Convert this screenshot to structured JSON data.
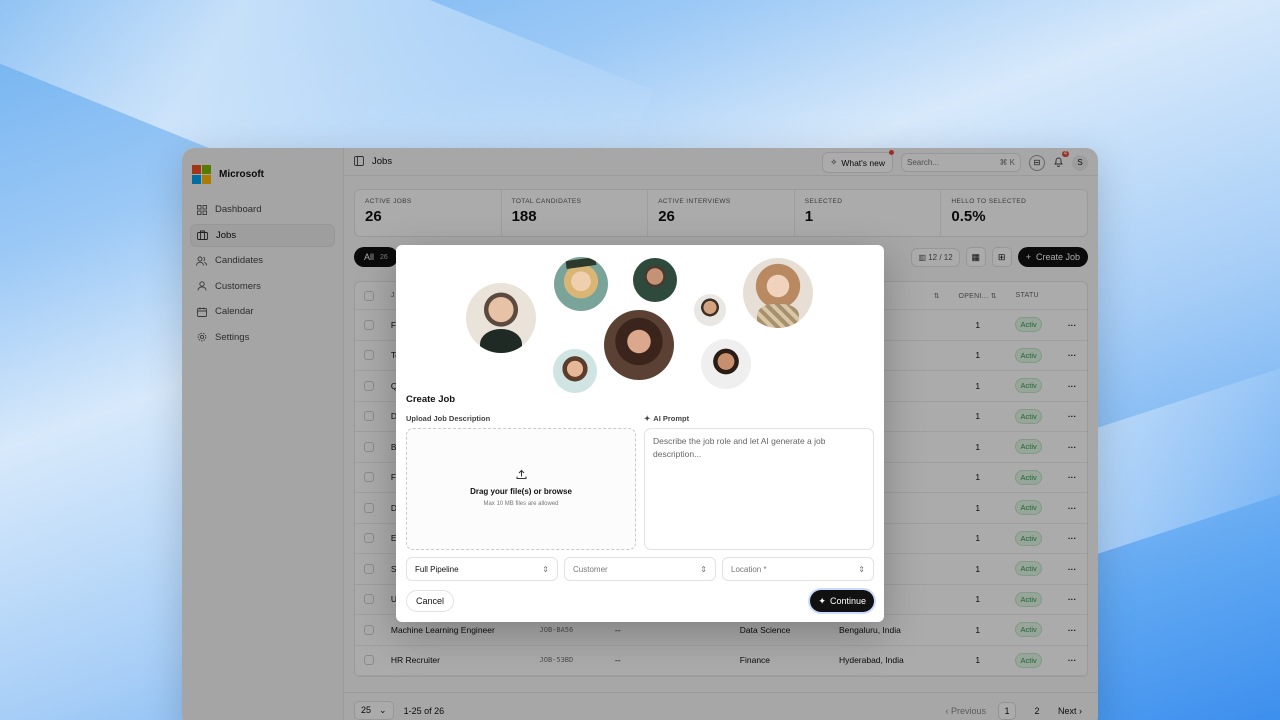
{
  "app": {
    "brand": "Microsoft",
    "brand_colors": [
      "#f25022",
      "#7fba00",
      "#00a4ef",
      "#ffb900"
    ]
  },
  "sidebar": {
    "items": [
      {
        "label": "Dashboard",
        "icon": "grid-icon"
      },
      {
        "label": "Jobs",
        "icon": "briefcase-icon",
        "active": true
      },
      {
        "label": "Candidates",
        "icon": "users-icon"
      },
      {
        "label": "Customers",
        "icon": "user-icon"
      },
      {
        "label": "Calendar",
        "icon": "calendar-icon"
      },
      {
        "label": "Settings",
        "icon": "gear-icon"
      }
    ]
  },
  "topbar": {
    "breadcrumb": "Jobs",
    "whats_new": "What's new",
    "search_placeholder": "Search...",
    "search_shortcut": "⌘ K",
    "notification_count": "4",
    "user_initial": "S"
  },
  "stats": [
    {
      "label": "ACTIVE JOBS",
      "value": "26"
    },
    {
      "label": "TOTAL CANDIDATES",
      "value": "188"
    },
    {
      "label": "ACTIVE INTERVIEWS",
      "value": "26"
    },
    {
      "label": "SELECTED",
      "value": "1"
    },
    {
      "label": "HELLO TO SELECTED",
      "value": "0.5%"
    }
  ],
  "toolbar": {
    "filter_all": "All",
    "filter_count": "26",
    "column_count": "12 / 12",
    "create_job": "Create Job"
  },
  "table": {
    "headers": {
      "title": "J",
      "openings": "OPENI...",
      "status": "STATU"
    },
    "rows": [
      {
        "title": "Fu",
        "code": "",
        "customer": "",
        "dept": "",
        "location": "u, India",
        "openings": "1",
        "status": "Activ"
      },
      {
        "title": "Te",
        "code": "",
        "customer": "",
        "dept": "",
        "location": "u, India",
        "openings": "1",
        "status": "Activ"
      },
      {
        "title": "Qu",
        "code": "",
        "customer": "",
        "dept": "",
        "location": "u, India",
        "openings": "1",
        "status": "Activ"
      },
      {
        "title": "Da",
        "code": "",
        "customer": "",
        "dept": "",
        "location": "u, India",
        "openings": "1",
        "status": "Activ"
      },
      {
        "title": "Ba",
        "code": "",
        "customer": "",
        "dept": "",
        "location": "u, India",
        "openings": "1",
        "status": "Activ"
      },
      {
        "title": "Fr",
        "code": "",
        "customer": "",
        "dept": "",
        "location": "u, India",
        "openings": "1",
        "status": "Activ"
      },
      {
        "title": "De",
        "code": "",
        "customer": "",
        "dept": "",
        "location": "u, India",
        "openings": "1",
        "status": "Activ"
      },
      {
        "title": "En",
        "code": "",
        "customer": "",
        "dept": "",
        "location": "u, India",
        "openings": "1",
        "status": "Activ"
      },
      {
        "title": "Sr",
        "code": "",
        "customer": "",
        "dept": "",
        "location": "u, India",
        "openings": "1",
        "status": "Activ"
      },
      {
        "title": "UX",
        "code": "",
        "customer": "",
        "dept": "",
        "location": "u, India",
        "openings": "1",
        "status": "Activ"
      },
      {
        "title": "Machine Learning Engineer",
        "code": "JOB-BA56",
        "customer": "--",
        "dept": "Data Science",
        "location": "Bengaluru, India",
        "openings": "1",
        "status": "Activ"
      },
      {
        "title": "HR Recruiter",
        "code": "JOB-53BD",
        "customer": "--",
        "dept": "Finance",
        "location": "Hyderabad, India",
        "openings": "1",
        "status": "Activ"
      }
    ]
  },
  "footer": {
    "per_page": "25",
    "range": "1-25 of 26",
    "previous": "Previous",
    "pages": [
      "1",
      "2"
    ],
    "next": "Next"
  },
  "modal": {
    "title": "Create Job",
    "upload_label": "Upload Job Description",
    "dropzone_title": "Drag your file(s) or browse",
    "dropzone_sub": "Max 10 MB files are allowed",
    "ai_label": "AI Prompt",
    "ai_placeholder": "Describe the job role and let AI generate a job description...",
    "pipeline_select": "Full Pipeline",
    "customer_placeholder": "Customer",
    "location_placeholder": "Location *",
    "cancel": "Cancel",
    "continue": "Continue"
  }
}
